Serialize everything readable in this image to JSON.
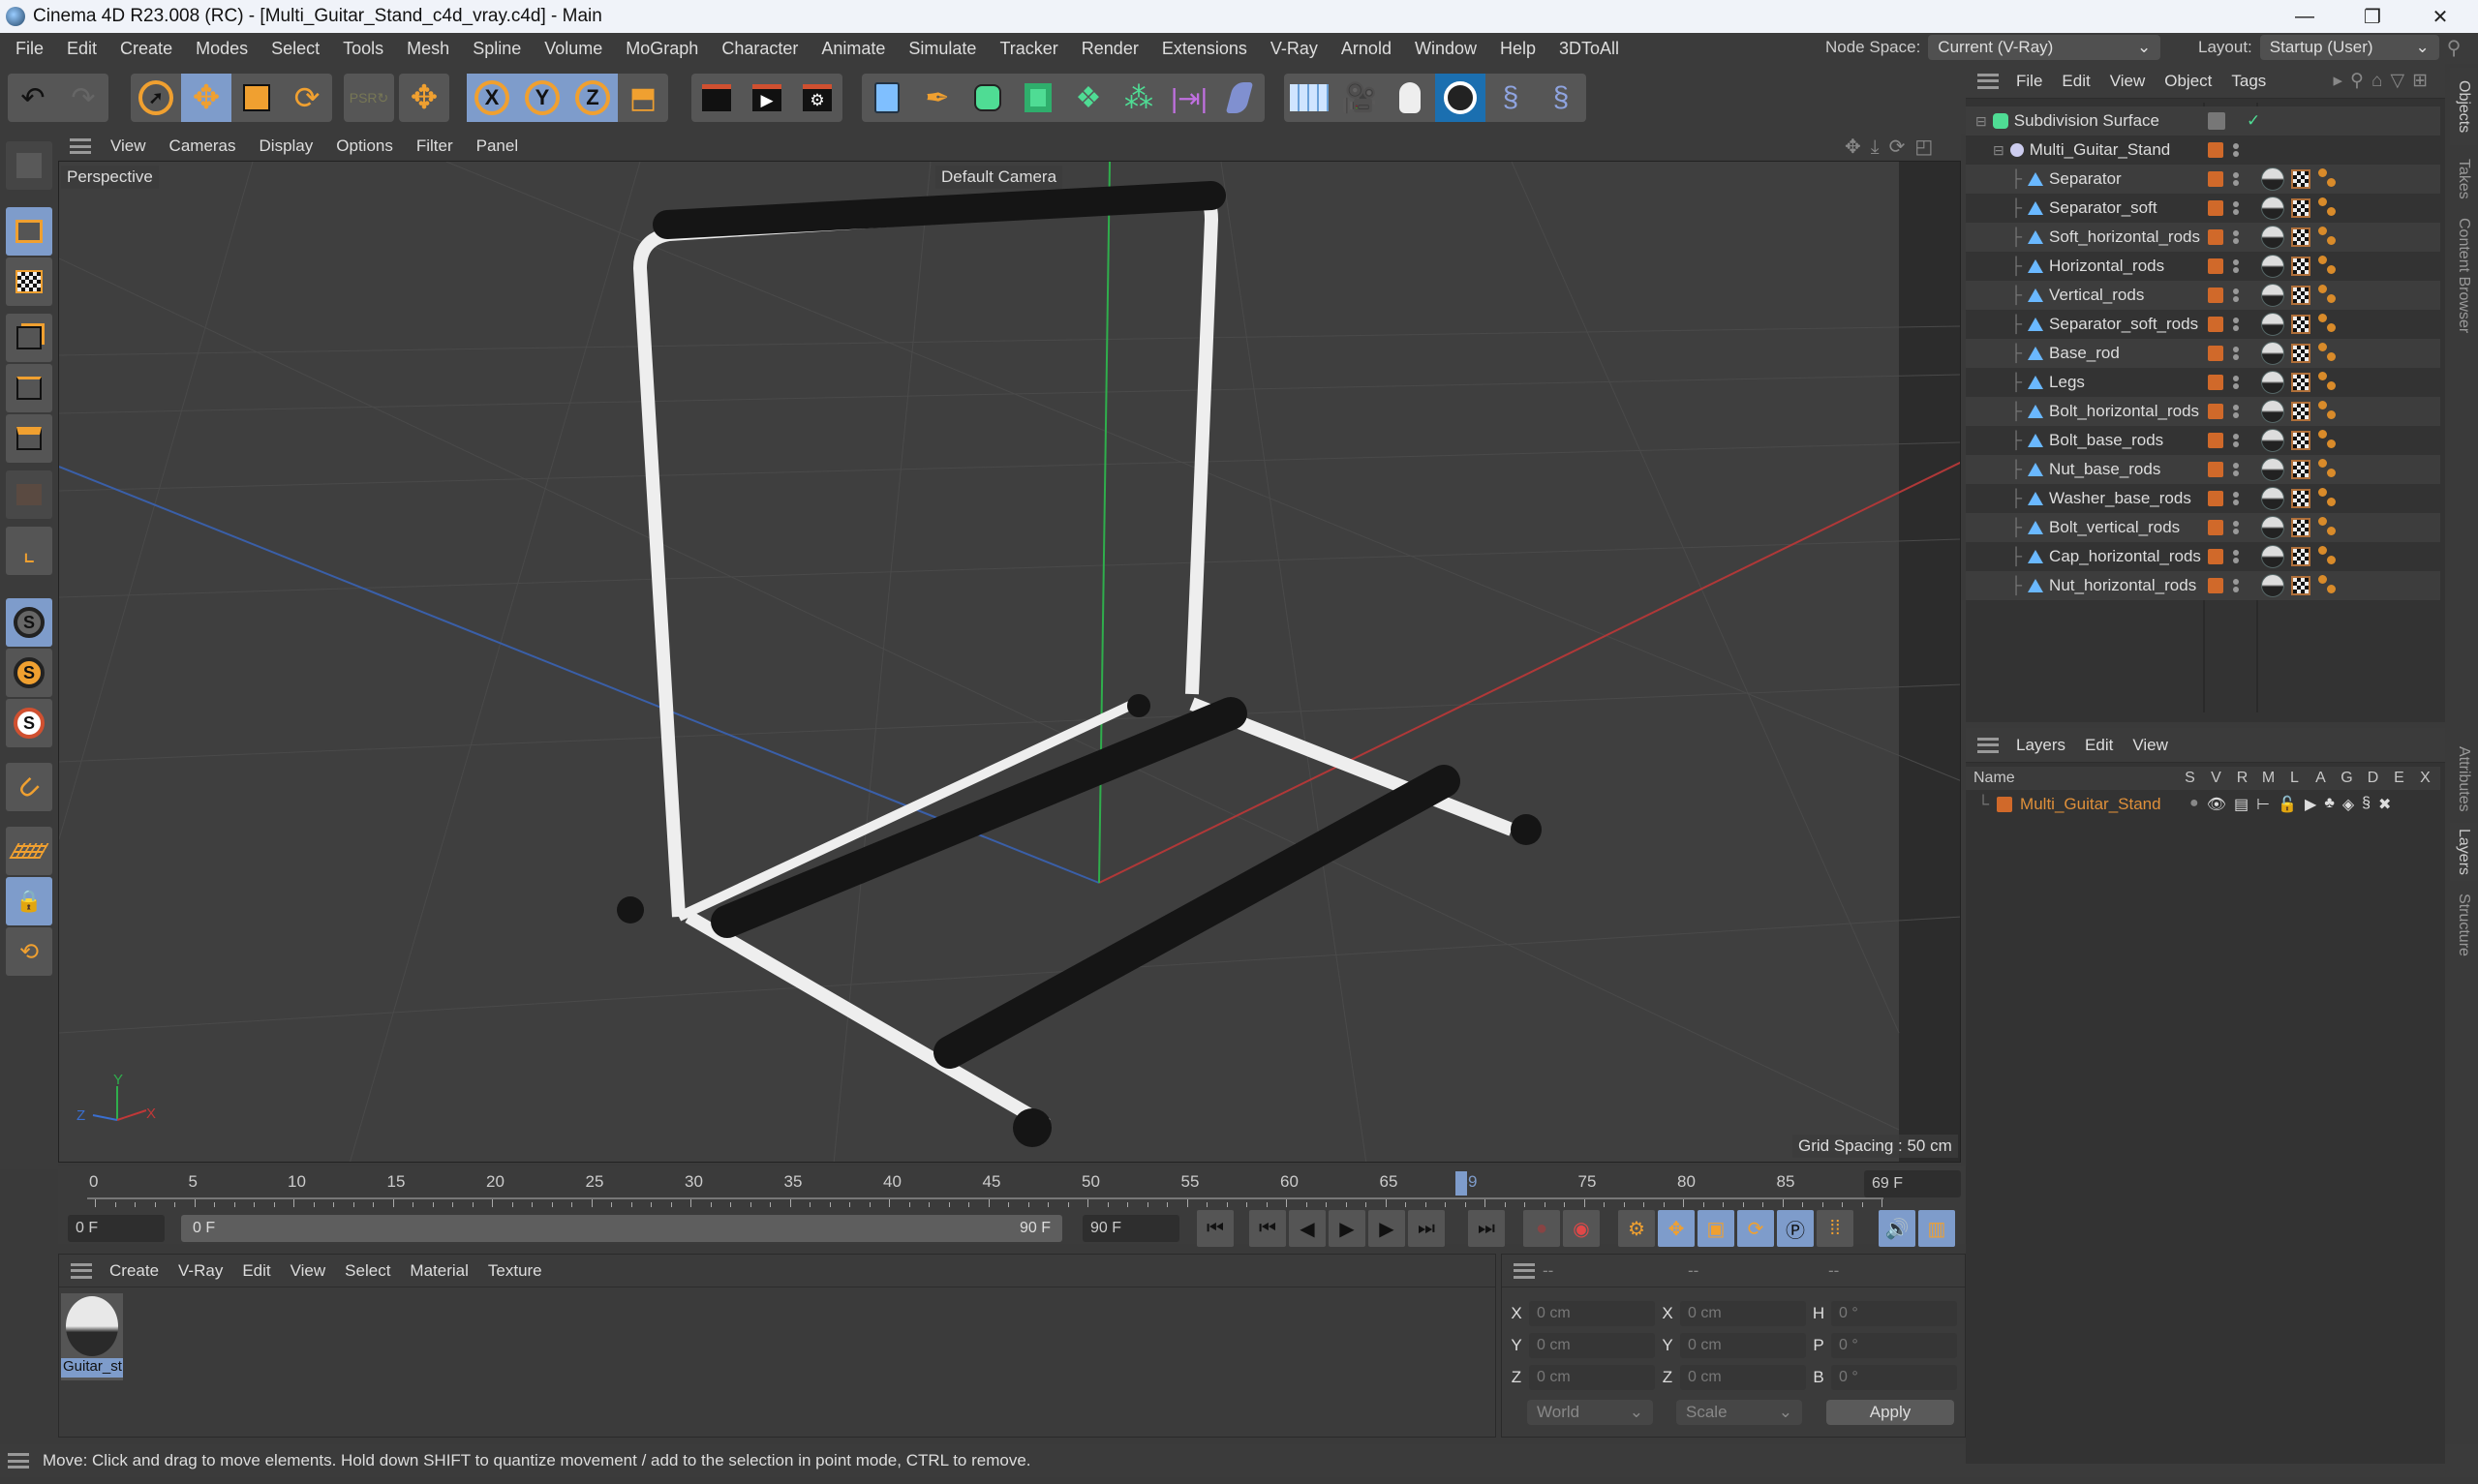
{
  "window": {
    "title": "Cinema 4D R23.008 (RC) - [Multi_Guitar_Stand_c4d_vray.c4d] - Main",
    "minimize": "—",
    "restore": "❐",
    "close": "✕"
  },
  "menubar": [
    "File",
    "Edit",
    "Create",
    "Modes",
    "Select",
    "Tools",
    "Mesh",
    "Spline",
    "Volume",
    "MoGraph",
    "Character",
    "Animate",
    "Simulate",
    "Tracker",
    "Render",
    "Extensions",
    "V-Ray",
    "Arnold",
    "Window",
    "Help",
    "3DToAll"
  ],
  "node_space": {
    "label": "Node Space:",
    "value": "Current (V-Ray)"
  },
  "layout": {
    "label": "Layout:",
    "value": "Startup (User)"
  },
  "toolbar": {
    "axis_x": "X",
    "axis_y": "Y",
    "axis_z": "Z"
  },
  "left_toolbar": {
    "s1": "S",
    "s2": "S",
    "s3": "S"
  },
  "viewport": {
    "menu": [
      "View",
      "Cameras",
      "Display",
      "Options",
      "Filter",
      "Panel"
    ],
    "view_name": "Perspective",
    "camera": "Default Camera",
    "grid_spacing": "Grid Spacing : 50 cm",
    "axis": {
      "x": "X",
      "y": "Y",
      "z": "Z"
    }
  },
  "timeline": {
    "ticks": [
      "0",
      "5",
      "10",
      "15",
      "20",
      "25",
      "30",
      "35",
      "40",
      "45",
      "50",
      "55",
      "60",
      "65",
      "69",
      "75",
      "80",
      "85",
      "90"
    ],
    "current_frame": "69 F",
    "current_frame_value": 69,
    "max_frame": 90,
    "start_field": "0 F",
    "range_start": "0 F",
    "range_end": "90 F",
    "end_field": "90 F"
  },
  "material_panel": {
    "menu": [
      "Create",
      "V-Ray",
      "Edit",
      "View",
      "Select",
      "Material",
      "Texture"
    ],
    "materials": [
      {
        "name": "Guitar_st"
      }
    ]
  },
  "coord_panel": {
    "headers": [
      "--",
      "--",
      "--"
    ],
    "rows": [
      {
        "l1": "X",
        "v1": "0 cm",
        "l2": "X",
        "v2": "0 cm",
        "l3": "H",
        "v3": "0 °"
      },
      {
        "l1": "Y",
        "v1": "0 cm",
        "l2": "Y",
        "v2": "0 cm",
        "l3": "P",
        "v3": "0 °"
      },
      {
        "l1": "Z",
        "v1": "0 cm",
        "l2": "Z",
        "v2": "0 cm",
        "l3": "B",
        "v3": "0 °"
      }
    ],
    "coord_system": "World",
    "mode": "Scale",
    "apply": "Apply"
  },
  "status": "Move: Click and drag to move elements. Hold down SHIFT to quantize movement / add to the selection in point mode, CTRL to remove.",
  "object_manager": {
    "menu": [
      "File",
      "Edit",
      "View",
      "Object",
      "Tags"
    ],
    "root": "Subdivision Surface",
    "group": "Multi_Guitar_Stand",
    "children": [
      "Separator",
      "Separator_soft",
      "Soft_horizontal_rods",
      "Horizontal_rods",
      "Vertical_rods",
      "Separator_soft_rods",
      "Base_rod",
      "Legs",
      "Bolt_horizontal_rods",
      "Bolt_base_rods",
      "Nut_base_rods",
      "Washer_base_rods",
      "Bolt_vertical_rods",
      "Cap_horizontal_rods",
      "Nut_horizontal_rods"
    ]
  },
  "layer_manager": {
    "menu": [
      "Layers",
      "Edit",
      "View"
    ],
    "columns": [
      "Name",
      "S",
      "V",
      "R",
      "M",
      "L",
      "A",
      "G",
      "D",
      "E",
      "X"
    ],
    "layers": [
      {
        "name": "Multi_Guitar_Stand",
        "color": "#d0692a"
      }
    ]
  },
  "side_tabs": {
    "top": [
      "Objects",
      "Takes",
      "Content Browser"
    ],
    "bottom": [
      "Attributes",
      "Layers",
      "Structure"
    ]
  },
  "colors": {
    "accent": "#7e9ccb",
    "orange": "#f0a030",
    "layer": "#d0692a"
  }
}
